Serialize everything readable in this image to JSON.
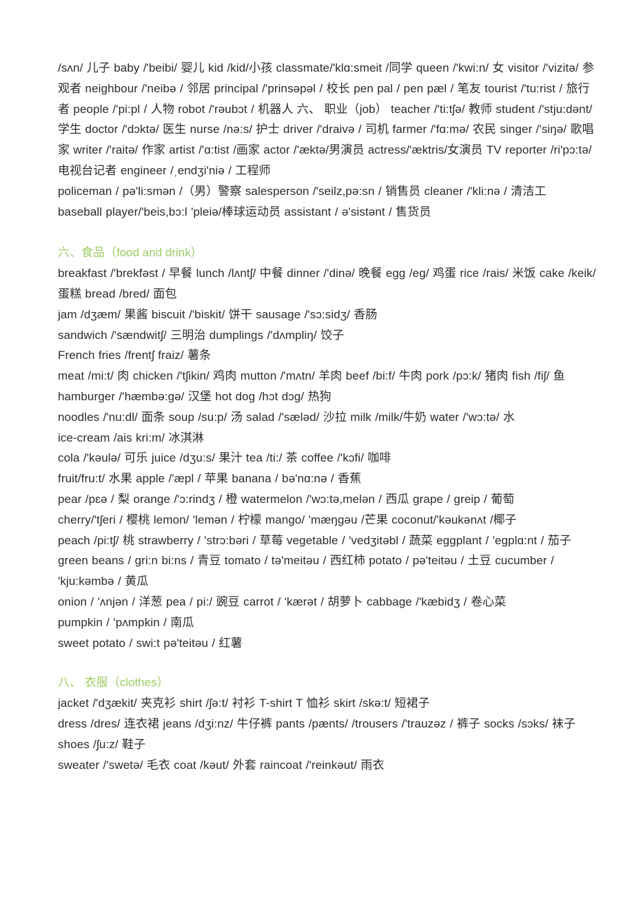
{
  "document": {
    "type": "vocabulary-word-list",
    "language": "English-Chinese",
    "heading_color": "#9ccc65",
    "body_color": "#2b2b2b"
  },
  "sections": [
    {
      "id": "people-and-jobs",
      "heading": null,
      "lines": [
        "/sʌn/  儿子  baby /'beibi/  婴儿  kid /kid/小孩  classmate/'klɑ:smeit /同学  queen /'kwi:n/  女  visitor /'vizitə/  参观者  neighbour /'neibə /  邻居  principal /'prinsəpəl /  校长  pen pal / pen pæl /  笔友  tourist /'tu:rist /  旅行者  people /'pi:pl /  人物  robot /'rəubɔt /  机器人  六、 职业（job）  teacher /'ti:tʃə/  教师  student /'stju:dənt/学生  doctor /'dɔktə/  医生  nurse /nə:s/  护士  driver /'draivə /  司机  farmer /'fɑ:mə/  农民  singer /'siŋə/  歌唱家  writer /'raitə/  作家  artist /'ɑ:tist /画家  actor /'æktə/男演员  actress/'æktris/女演员  TV reporter /ri'pɔ:tə/  电视台记者  engineer /ˌendʒi'niə /  工程师",
        "policeman / pə'li:smən /（男）警察  salesperson /'seilz,pə:sn /  销售员  cleaner /'kli:nə /  清洁工",
        "baseball player/'beis,bɔ:l 'pleiə/棒球运动员  assistant / ə'sistənt /  售货员"
      ]
    },
    {
      "id": "food-and-drink",
      "heading": "六、食品（food and drink）",
      "lines": [
        "breakfast /'brekfəst /  早餐  lunch /lʌntʃ/  中餐 dinner /'dinə/  晚餐  egg /eg/  鸡蛋  rice /rais/  米饭  cake /keik/  蛋糕  bread /bred/  面包",
        "jam /dʒæm/  果酱  biscuit /'biskit/  饼干  sausage /'sɔ:sidʒ/  香肠",
        "sandwich /'sændwitʃ/  三明治  dumplings /'dʌmpliŋ/  饺子",
        "French fries /frentʃ fraiz/  薯条",
        "meat /mi:t/  肉  chicken /'tʃikin/  鸡肉  mutton /'mʌtn/  羊肉  beef /bi:f/  牛肉  pork /pɔ:k/  猪肉  fish /fiʃ/  鱼  hamburger /'hæmbə:gə/  汉堡  hot dog /hɔt dɔg/  热狗",
        "noodles /'nu:dl/  面条  soup /su:p/  汤  salad /'sæləd/  沙拉  milk /milk/牛奶  water /'wɔ:tə/  水",
        "ice-cream /ais kri:m/  冰淇淋",
        "cola /'kəulə/  可乐  juice /dʒu:s/  果汁  tea /ti:/  茶  coffee /'kɔfi/  咖啡",
        "fruit/fru:t/  水果  apple /'æpl /  苹果  banana / bə'nɑ:nə /  香蕉",
        "pear /pɛə /  梨  orange /'ɔ:rindʒ /  橙  watermelon /'wɔ:tə,melən /  西瓜  grape / greip /  葡萄",
        "cherry/'tʃeri /  樱桃  lemon/ 'lemən /  柠檬  mango/ 'mæŋgəu /芒果  coconut/'kəukənʌt /椰子",
        "peach /pi:tʃ/  桃  strawberry / 'strɔ:bəri /  草莓  vegetable / 'vedʒitəbl /  蔬菜  eggplant / 'egplɑ:nt /  茄子  green beans / gri:n bi:ns /  青豆  tomato / tə'meitəu /  西红柿  potato / pə'teitəu /  土豆  cucumber / 'kju:kəmbə /  黄瓜",
        "onion / 'ʌnjən /  洋葱  pea / pi:/  豌豆  carrot / 'kærət /  胡萝卜  cabbage /'kæbidʒ /  卷心菜",
        "pumpkin / 'pʌmpkin /  南瓜",
        "sweet potato / swi:t pə'teitəu /  红薯"
      ]
    },
    {
      "id": "clothes",
      "heading": "八、 衣服（clothes）",
      "lines": [
        "jacket /'dʒækit/  夹克衫  shirt /ʃə:t/  衬衫  T-shirt T 恤衫  skirt /skə:t/  短裙子",
        "dress /dres/  连衣裙  jeans /dʒi:nz/  牛仔裤  pants /pænts/ /trousers /'trauzəz /  裤子  socks /sɔks/  袜子  shoes /ʃu:z/  鞋子",
        "sweater /'swetə/  毛衣  coat /kəut/  外套  raincoat /'reinkəut/  雨衣"
      ]
    }
  ]
}
